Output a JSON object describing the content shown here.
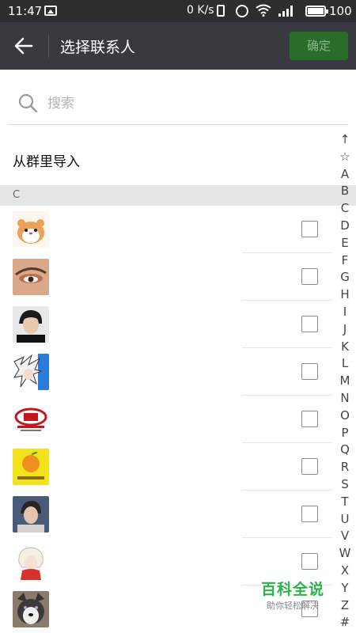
{
  "status_bar": {
    "time": "11:47",
    "net_speed": "0 K/s",
    "battery": "100"
  },
  "header": {
    "title": "选择联系人",
    "confirm_label": "确定",
    "confirm_bg": "#2a6c2a"
  },
  "search": {
    "placeholder": "搜索",
    "value": ""
  },
  "import_from_group": "从群里导入",
  "section_letter": "C",
  "contacts": [
    {
      "avatar": "hamster-cartoon",
      "checked": false
    },
    {
      "avatar": "eye-makeup-closeup",
      "checked": false
    },
    {
      "avatar": "boy-portrait",
      "checked": false
    },
    {
      "avatar": "anime-white-hair",
      "checked": false
    },
    {
      "avatar": "cz-red-logo",
      "checked": false
    },
    {
      "avatar": "orange-fruit-logo",
      "checked": false
    },
    {
      "avatar": "boy-blue-portrait",
      "checked": false
    },
    {
      "avatar": "anime-girl-white",
      "checked": false
    },
    {
      "avatar": "husky-dog",
      "checked": false
    }
  ],
  "index_letters": [
    "↑",
    "☆",
    "A",
    "B",
    "C",
    "D",
    "E",
    "F",
    "G",
    "H",
    "I",
    "J",
    "K",
    "L",
    "M",
    "N",
    "O",
    "P",
    "Q",
    "R",
    "S",
    "T",
    "U",
    "V",
    "W",
    "X",
    "Y",
    "Z",
    "#"
  ],
  "watermark": {
    "title": "百科全说",
    "subtitle": "助你轻松解决"
  },
  "colors": {
    "header_bg": "#393a3f",
    "status_bg": "#2e2e2e",
    "section_bg": "#e6e6e6",
    "watermark_green": "#2bb34a"
  }
}
